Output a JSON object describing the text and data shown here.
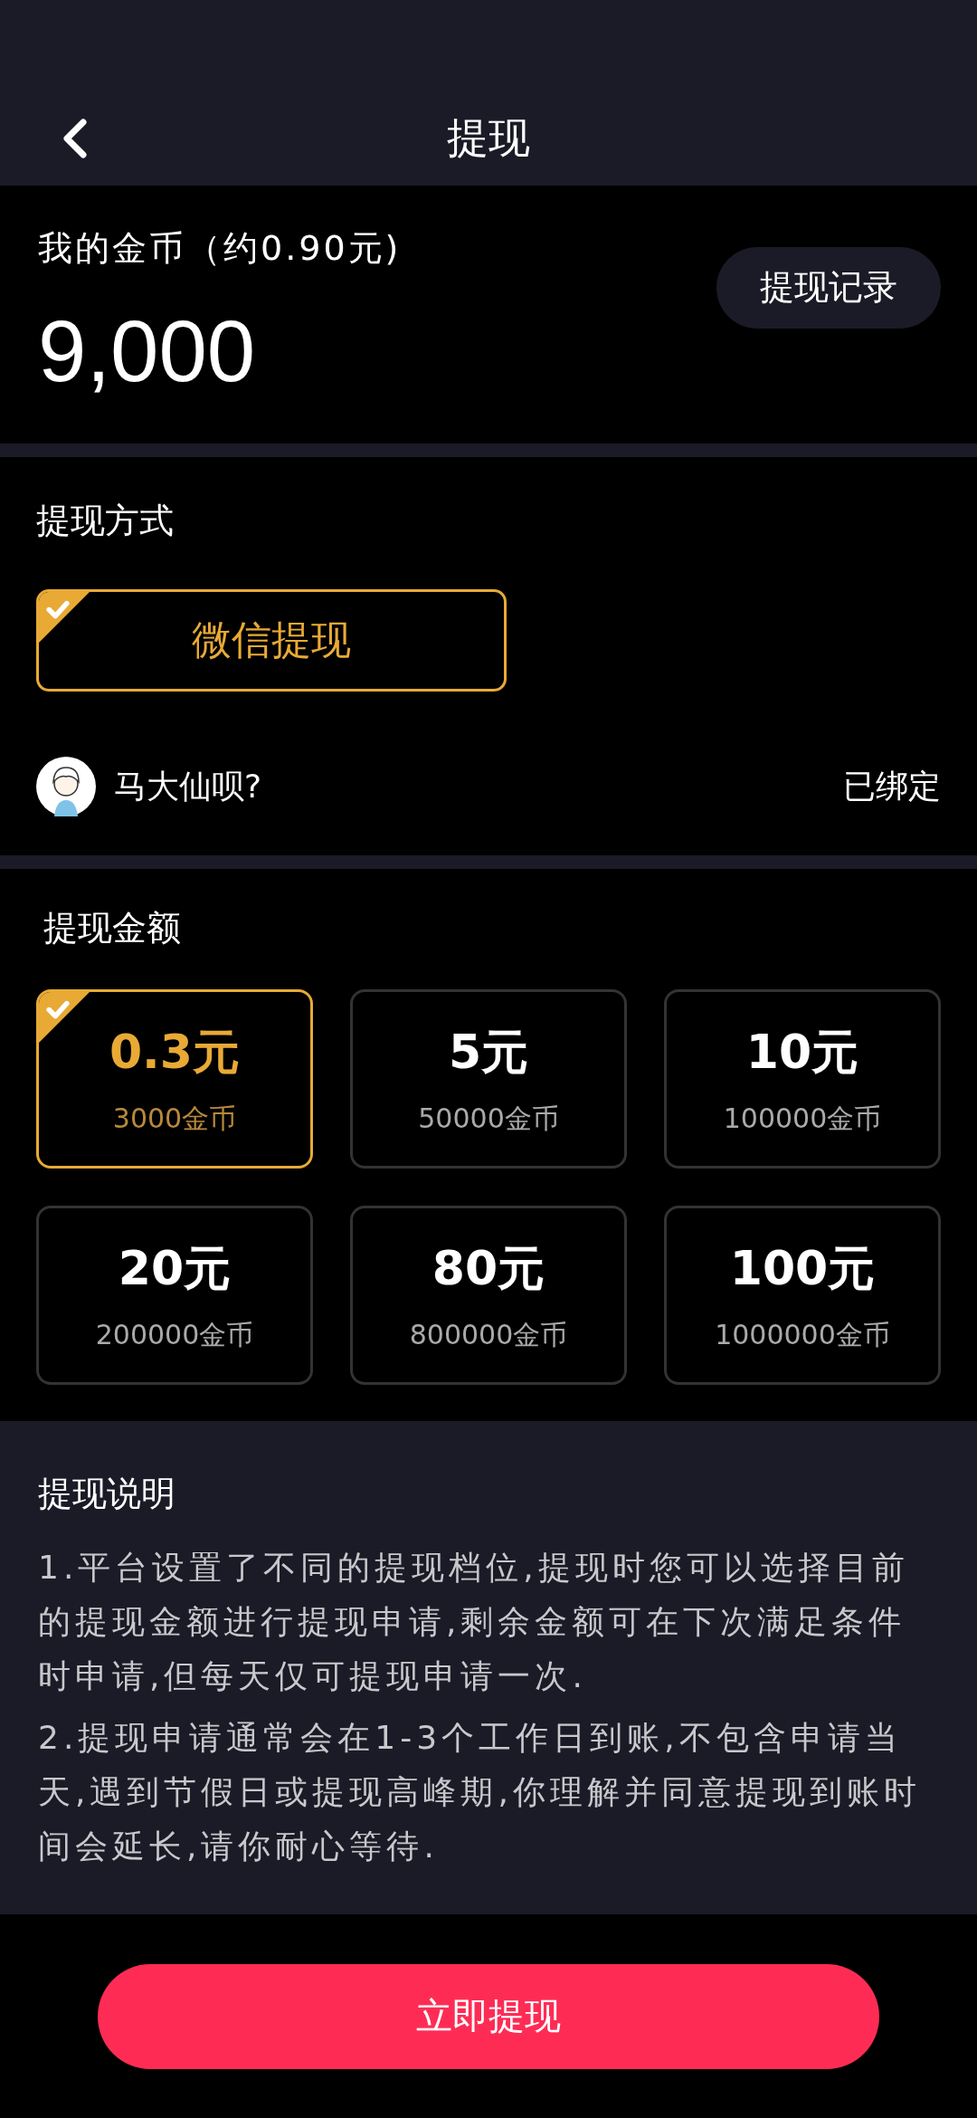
{
  "header": {
    "title": "提现"
  },
  "coins": {
    "label": "我的金币（约0.90元)",
    "amount": "9,000",
    "history_button": "提现记录"
  },
  "method": {
    "title": "提现方式",
    "options": [
      {
        "label": "微信提现",
        "selected": true
      }
    ],
    "account": {
      "name": "马大仙呗?",
      "status": "已绑定"
    }
  },
  "amounts": {
    "title": "提现金额",
    "options": [
      {
        "value": "0.3元",
        "coins": "3000金币",
        "selected": true
      },
      {
        "value": "5元",
        "coins": "50000金币",
        "selected": false
      },
      {
        "value": "10元",
        "coins": "100000金币",
        "selected": false
      },
      {
        "value": "20元",
        "coins": "200000金币",
        "selected": false
      },
      {
        "value": "80元",
        "coins": "800000金币",
        "selected": false
      },
      {
        "value": "100元",
        "coins": "1000000金币",
        "selected": false
      }
    ]
  },
  "notes": {
    "title": "提现说明",
    "items": [
      "1.平台设置了不同的提现档位,提现时您可以选择目前的提现金额进行提现申请,剩余金额可在下次满足条件时申请,但每天仅可提现申请一次.",
      "2.提现申请通常会在1-3个工作日到账,不包含申请当天,遇到节假日或提现高峰期,你理解并同意提现到账时间会延长,请你耐心等待."
    ]
  },
  "submit_button": "立即提现"
}
